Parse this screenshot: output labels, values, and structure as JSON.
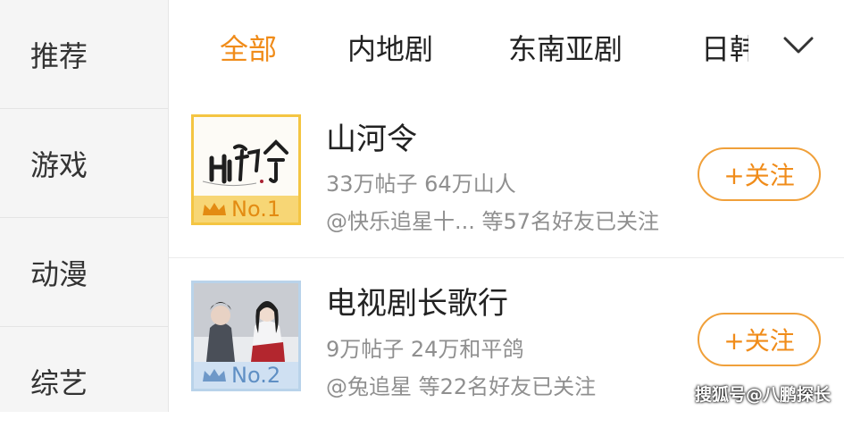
{
  "sidebar": {
    "items": [
      {
        "label": "推荐"
      },
      {
        "label": "游戏"
      },
      {
        "label": "动漫"
      },
      {
        "label": "综艺"
      }
    ]
  },
  "tabs": {
    "items": [
      {
        "label": "全部",
        "active": true
      },
      {
        "label": "内地剧",
        "active": false
      },
      {
        "label": "东南亚剧",
        "active": false
      },
      {
        "label": "日韩",
        "active": false
      }
    ],
    "more_icon": "chevron-down-icon"
  },
  "list": [
    {
      "title": "山河令",
      "stats": "33万帖子 64万山人",
      "friends": "@快乐追星十... 等57名好友已关注",
      "rank": "No.1",
      "rank_color": "#e38b12",
      "follow_label": "+关注"
    },
    {
      "title": "电视剧长歌行",
      "stats": "9万帖子 24万和平鸽",
      "friends": "@兔追星 等22名好友已关注",
      "rank": "No.2",
      "rank_color": "#5f8fc4",
      "follow_label": "+关注"
    }
  ],
  "watermark": "搜狐号@八鹏探长",
  "colors": {
    "accent": "#f08c1a",
    "sidebar_bg": "#f5f5f5",
    "gold": "#f7d675",
    "blue": "#cfe0f2"
  }
}
